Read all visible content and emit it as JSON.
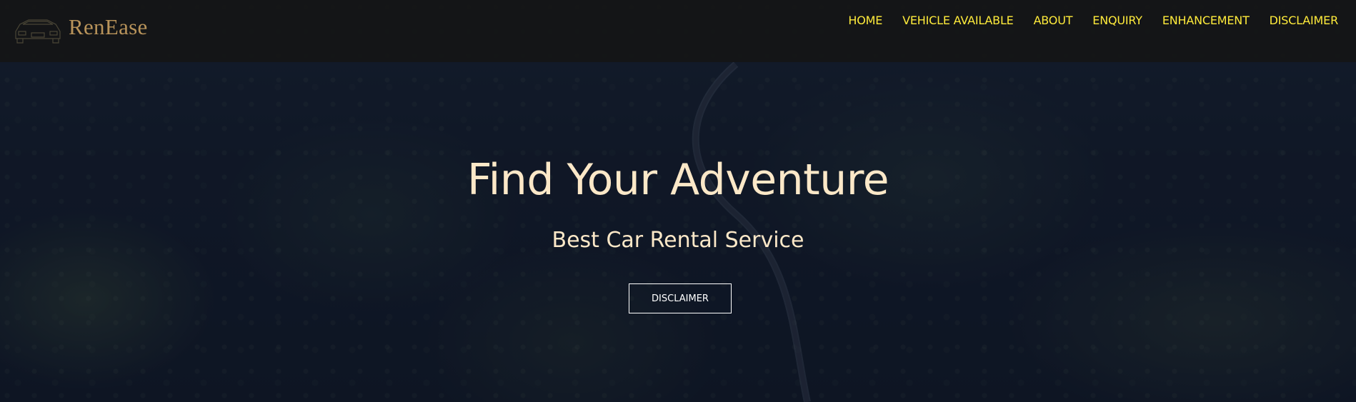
{
  "brand": {
    "name": "RenEase",
    "logo_icon": "car-outline-icon"
  },
  "nav": {
    "items": [
      {
        "label": "HOME"
      },
      {
        "label": "VEHICLE AVAILABLE"
      },
      {
        "label": "ABOUT"
      },
      {
        "label": "ENQUIRY"
      },
      {
        "label": "ENHANCEMENT"
      },
      {
        "label": "DISCLAIMER"
      }
    ]
  },
  "hero": {
    "title": "Find Your Adventure",
    "subtitle": "Best Car Rental Service",
    "button_label": "DISCLAIMER",
    "background": "forest-road-aerial-image"
  },
  "colors": {
    "nav_text": "#ffeb3b",
    "brand": "#b8935a",
    "hero_text": "#fce8c8",
    "navbar_bg": "#141414"
  }
}
